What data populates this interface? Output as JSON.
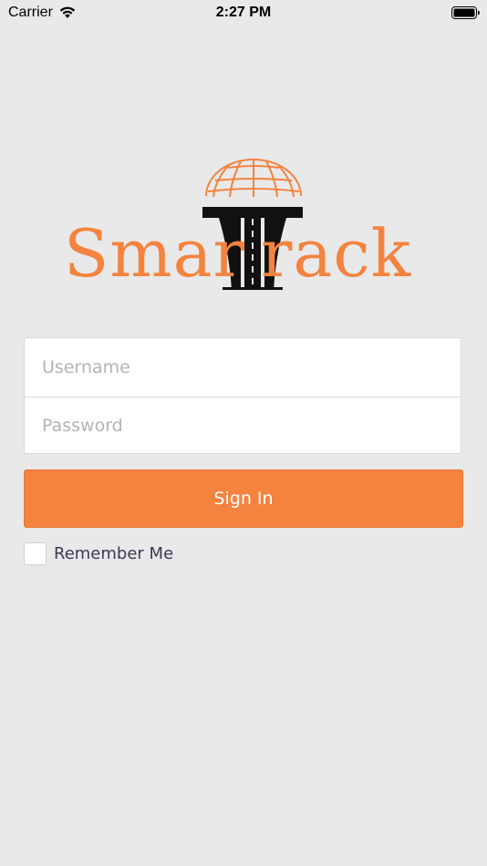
{
  "status_bar": {
    "carrier": "Carrier",
    "time": "2:27 PM",
    "icons": [
      "wifi-icon",
      "battery-icon"
    ]
  },
  "logo": {
    "text_left": "Smar",
    "text_right": "rack",
    "colors": {
      "orange": "#f4833f",
      "black": "#111111"
    }
  },
  "login_form": {
    "username_placeholder": "Username",
    "password_placeholder": "Password",
    "signin_label": "Sign In",
    "remember_label": "Remember Me",
    "remember_checked": false
  },
  "colors": {
    "background": "#e9e9ea",
    "accent": "#f4833f",
    "card": "#ffffff",
    "label_text": "#3a3a52"
  }
}
